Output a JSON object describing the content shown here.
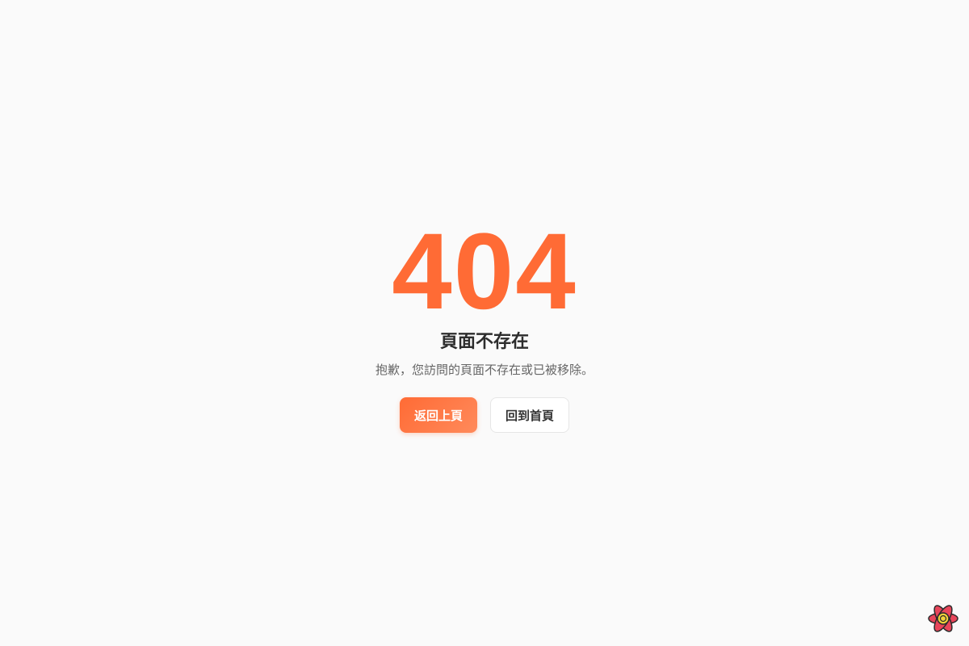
{
  "error": {
    "code": "404",
    "title": "頁面不存在",
    "description": "抱歉，您訪問的頁面不存在或已被移除。"
  },
  "actions": {
    "back_label": "返回上頁",
    "home_label": "回到首頁"
  },
  "colors": {
    "accent": "#ff6b35",
    "background": "#fafafa",
    "title_text": "#2d2d2d",
    "description_text": "#666666"
  },
  "icons": {
    "corner_logo": "atom-logo-icon"
  }
}
